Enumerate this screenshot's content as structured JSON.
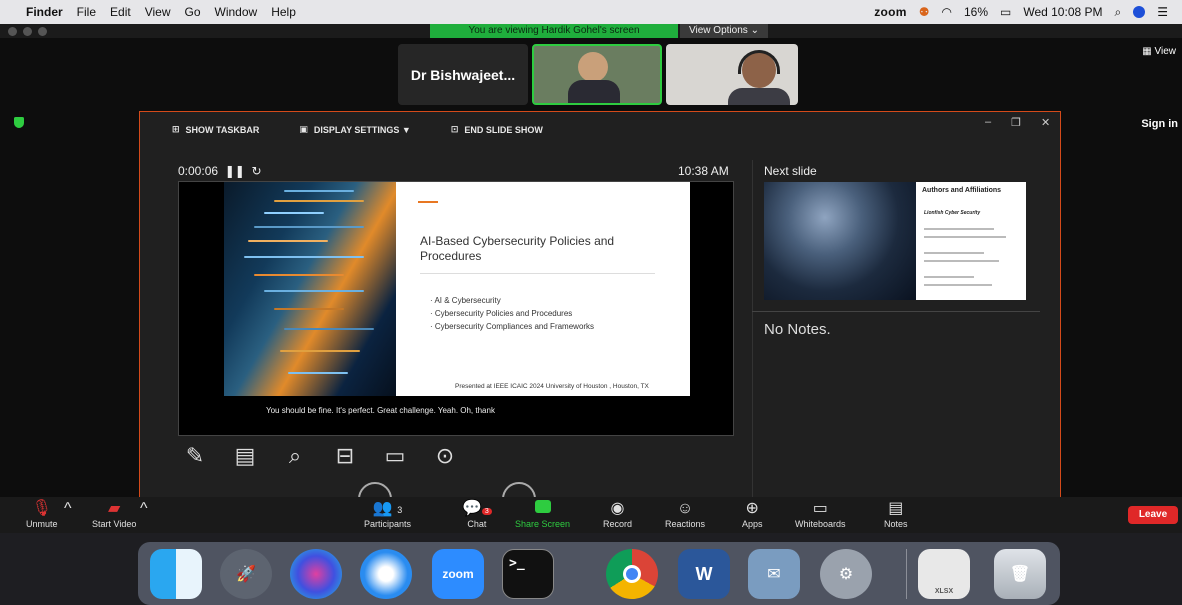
{
  "menubar": {
    "items": [
      "Finder",
      "File",
      "Edit",
      "View",
      "Go",
      "Window",
      "Help"
    ],
    "right": {
      "app": "zoom",
      "battery": "16%",
      "datetime": "Wed 10:08 PM"
    }
  },
  "zoom": {
    "viewing_banner": "You are viewing Hardik Gohel's screen",
    "view_options": "View Options",
    "participant_name": "Dr Bishwajeet...",
    "view_button": "View",
    "sign_in": "Sign in"
  },
  "presenter": {
    "toolbar": {
      "show_taskbar": "SHOW TASKBAR",
      "display_settings": "DISPLAY SETTINGS ▼",
      "end_slide_show": "END SLIDE SHOW"
    },
    "timer": "0:00:06",
    "clock": "10:38 AM",
    "next_slide_label": "Next slide",
    "slide": {
      "title": "AI-Based Cybersecurity Policies and Procedures",
      "bullets": [
        "AI & Cybersecurity",
        "Cybersecurity Policies and Procedures",
        "Cybersecurity Compliances and Frameworks"
      ],
      "footer": "Presented at IEEE ICAIC 2024 University of Houston , Houston, TX"
    },
    "caption": "You should be fine. It's perfect. Great challenge. Yeah. Oh, thank",
    "next_slide": {
      "title": "Authors and Affiliations",
      "subtitle": "Lionfish Cyber Security"
    },
    "notes": "No Notes."
  },
  "controls": {
    "unmute": "Unmute",
    "start_video": "Start Video",
    "participants": "Participants",
    "participants_count": "3",
    "chat": "Chat",
    "chat_badge": "3",
    "share_screen": "Share Screen",
    "record": "Record",
    "reactions": "Reactions",
    "apps": "Apps",
    "whiteboards": "Whiteboards",
    "notes": "Notes",
    "leave": "Leave"
  },
  "dock": {
    "zoom_label": "zoom",
    "word_label": "W",
    "xlsx_label": "XLSX"
  },
  "colors": {
    "accent_green": "#1fae3c",
    "presenter_border": "#d44a1a",
    "leave_red": "#e02828"
  }
}
